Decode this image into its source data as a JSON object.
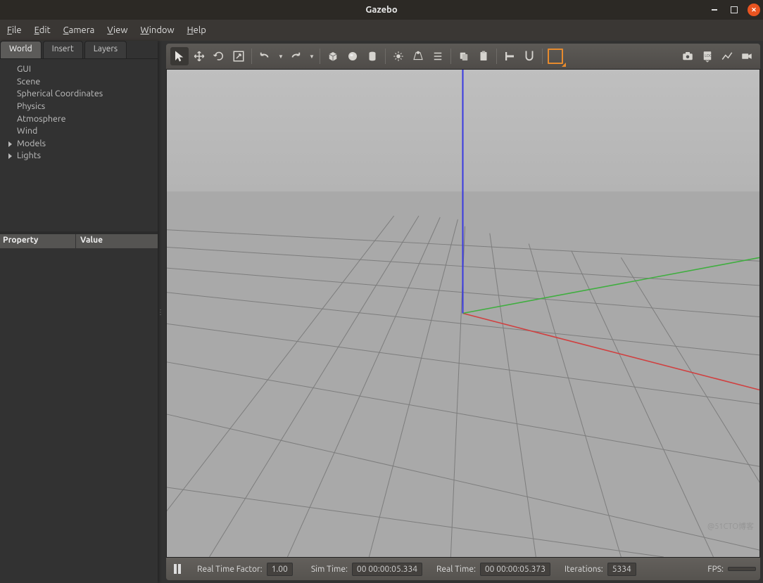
{
  "window": {
    "title": "Gazebo"
  },
  "menus": {
    "file": "File",
    "edit": "Edit",
    "camera": "Camera",
    "view": "View",
    "window": "Window",
    "help": "Help"
  },
  "left_tabs": {
    "world": "World",
    "insert": "Insert",
    "layers": "Layers"
  },
  "tree": {
    "items": [
      {
        "label": "GUI",
        "expandable": false
      },
      {
        "label": "Scene",
        "expandable": false
      },
      {
        "label": "Spherical Coordinates",
        "expandable": false
      },
      {
        "label": "Physics",
        "expandable": false
      },
      {
        "label": "Atmosphere",
        "expandable": false
      },
      {
        "label": "Wind",
        "expandable": false
      },
      {
        "label": "Models",
        "expandable": true
      },
      {
        "label": "Lights",
        "expandable": true
      }
    ]
  },
  "prop_header": {
    "property": "Property",
    "value": "Value"
  },
  "toolbar": {
    "icons": [
      "arrow-select",
      "move",
      "rotate",
      "scale",
      "sep",
      "undo",
      "undo-drop",
      "redo",
      "redo-drop",
      "sep",
      "box",
      "sphere",
      "cylinder",
      "sep",
      "sun-light",
      "spot-light",
      "directional-light",
      "sep",
      "copy",
      "paste",
      "sep",
      "align",
      "snap",
      "sep",
      "selection-box"
    ],
    "right_icons": [
      "camera",
      "log",
      "plot",
      "record"
    ]
  },
  "status": {
    "rtf_label": "Real Time Factor:",
    "rtf": "1.00",
    "simtime_label": "Sim Time:",
    "simtime": "00 00:00:05.334",
    "realtime_label": "Real Time:",
    "realtime": "00 00:00:05.373",
    "iterations_label": "Iterations:",
    "iterations": "5334",
    "fps_label": "FPS:",
    "fps": ""
  },
  "watermark": "@51CTO博客"
}
